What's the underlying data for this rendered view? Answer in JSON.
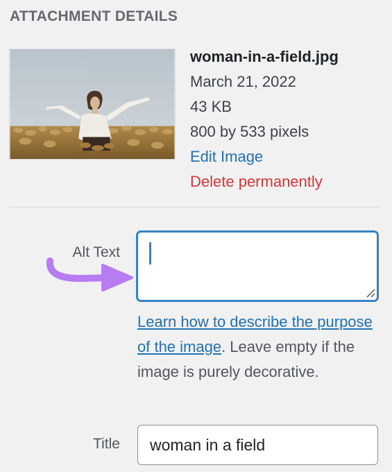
{
  "section": {
    "heading": "ATTACHMENT DETAILS"
  },
  "attachment": {
    "filename": "woman-in-a-field.jpg",
    "date": "March 21, 2022",
    "file_size": "43 KB",
    "dimensions": "800 by 533 pixels",
    "edit_link": "Edit Image",
    "delete_link": "Delete permanently",
    "thumbnail_icon": "photo-woman-in-field"
  },
  "alt_text": {
    "label": "Alt Text",
    "value": "",
    "help_link": "Learn how to describe the purpose of the image",
    "help_rest": ". Leave empty if the image is purely decorative."
  },
  "title_field": {
    "label": "Title",
    "value": "woman in a field"
  },
  "colors": {
    "link": "#2271b1",
    "delete": "#d63638",
    "focus_border": "#3582c4",
    "arrow": "#b77cf0",
    "background": "#f1f1f1"
  }
}
